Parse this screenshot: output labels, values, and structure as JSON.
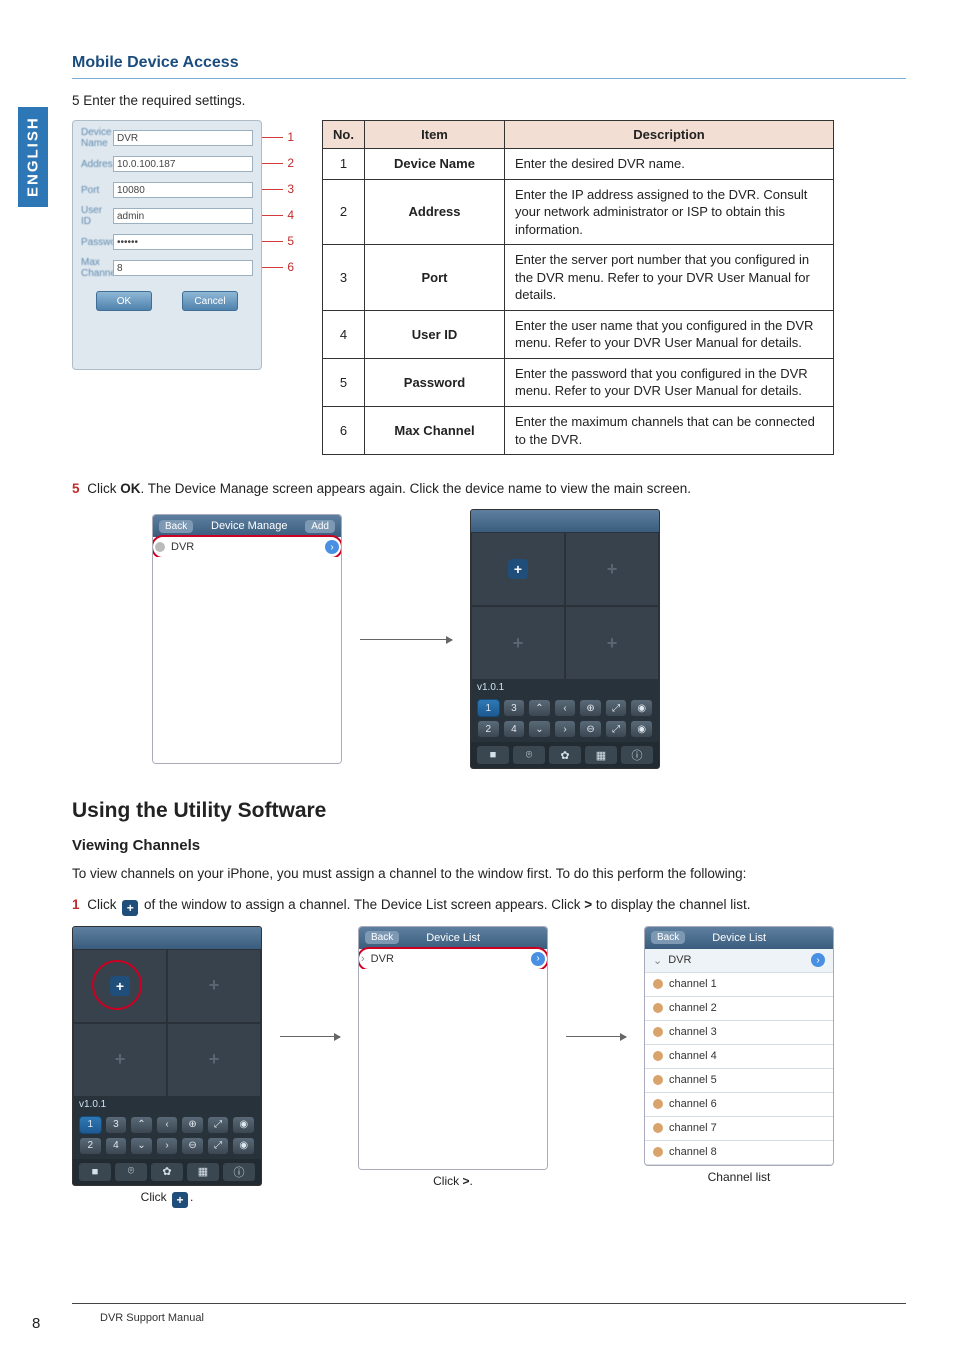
{
  "side_tab": "ENGLISH",
  "title": "Mobile Device Access",
  "step5_intro": "5 Enter the required settings.",
  "settings": {
    "labels": {
      "name": "Device Name",
      "addr": "Address",
      "port": "Port",
      "user": "User ID",
      "pass": "Password",
      "max": "Max Channel"
    },
    "values": {
      "name": "DVR",
      "addr": "10.0.100.187",
      "port": "10080",
      "user": "admin",
      "pass": "••••••",
      "max": "8"
    },
    "buttons": {
      "ok": "OK",
      "cancel": "Cancel"
    },
    "leads": [
      "1",
      "2",
      "3",
      "4",
      "5",
      "6"
    ]
  },
  "table": {
    "head": {
      "no": "No.",
      "item": "Item",
      "desc": "Description"
    },
    "rows": [
      {
        "no": "1",
        "item": "Device Name",
        "desc": "Enter the desired DVR name."
      },
      {
        "no": "2",
        "item": "Address",
        "desc": "Enter the IP address assigned to the DVR. Consult your network administrator or ISP to obtain this information."
      },
      {
        "no": "3",
        "item": "Port",
        "desc": "Enter the server port number that you configured in the DVR menu. Refer to your DVR User Manual for details."
      },
      {
        "no": "4",
        "item": "User ID",
        "desc": "Enter the user name that you configured in the DVR menu. Refer to your DVR User Manual for details."
      },
      {
        "no": "5",
        "item": "Password",
        "desc": "Enter the password that you configured in the DVR menu. Refer to your DVR User Manual for details."
      },
      {
        "no": "6",
        "item": "Max Channel",
        "desc": "Enter the maximum channels that can be connected to the DVR."
      }
    ]
  },
  "step5_ok": {
    "num": "5",
    "pre": " Click ",
    "ok": "OK",
    "post": ". The Device Manage screen appears again. Click the device name to view the main screen."
  },
  "devmanage": {
    "back": "Back",
    "title": "Device Manage",
    "add": "Add",
    "item": "DVR"
  },
  "viewer": {
    "version": "v1.0.1",
    "nums": [
      "1",
      "3",
      "2",
      "4"
    ],
    "icons": {
      "up": "⌃",
      "down": "⌄",
      "left": "‹",
      "right": "›",
      "zi": "⊕",
      "zo": "⊖",
      "full": "⤢",
      "rec": "◉",
      "stop": "■",
      "cam": "⌾",
      "gear": "✿",
      "grid": "▦",
      "info": "ⓘ"
    }
  },
  "util_h2": "Using the Utility Software",
  "viewch_h3": "Viewing Channels",
  "viewch_p": "To view channels on your iPhone, you must assign a channel to the window first. To do this perform the following:",
  "step1": {
    "num": "1",
    "pre": " Click ",
    "mid": " of the window to assign a channel. The Device List screen appears. Click ",
    "gt": ">",
    "post": " to display the channel list."
  },
  "devlist": {
    "back": "Back",
    "title": "Device List",
    "item": "DVR"
  },
  "channels": [
    "channel 1",
    "channel 2",
    "channel 3",
    "channel 4",
    "channel 5",
    "channel 6",
    "channel 7",
    "channel 8"
  ],
  "captions": {
    "a_pre": "Click ",
    "a_post": ".",
    "b_pre": "Click ",
    "b_bold": ">",
    "b_post": ".",
    "c": "Channel list"
  },
  "footer": "DVR Support Manual",
  "page_num": "8"
}
